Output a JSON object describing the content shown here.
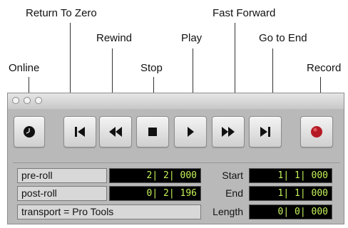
{
  "callouts": {
    "return_to_zero": "Return To Zero",
    "fast_forward": "Fast Forward",
    "rewind": "Rewind",
    "play": "Play",
    "go_to_end": "Go to End",
    "online": "Online",
    "stop": "Stop",
    "record": "Record"
  },
  "transport": {
    "buttons": [
      {
        "name": "online-button",
        "icon": "clock-icon"
      },
      {
        "name": "return-to-zero-button",
        "icon": "return-to-zero-icon"
      },
      {
        "name": "rewind-button",
        "icon": "rewind-icon"
      },
      {
        "name": "stop-button",
        "icon": "stop-icon"
      },
      {
        "name": "play-button",
        "icon": "play-icon"
      },
      {
        "name": "fast-forward-button",
        "icon": "fast-forward-icon"
      },
      {
        "name": "go-to-end-button",
        "icon": "go-to-end-icon"
      },
      {
        "name": "record-button",
        "icon": "record-icon"
      }
    ],
    "pre_roll_label": "pre-roll",
    "pre_roll_value": "2| 2| 000",
    "post_roll_label": "post-roll",
    "post_roll_value": "0| 2| 196",
    "transport_source": "transport = Pro Tools",
    "start_label": "Start",
    "start_value": "1| 1| 000",
    "end_label": "End",
    "end_value": "1| 1| 000",
    "length_label": "Length",
    "length_value": "0| 0| 000"
  },
  "colors": {
    "counter_text": "#c5f35b",
    "record": "#b51a24"
  }
}
